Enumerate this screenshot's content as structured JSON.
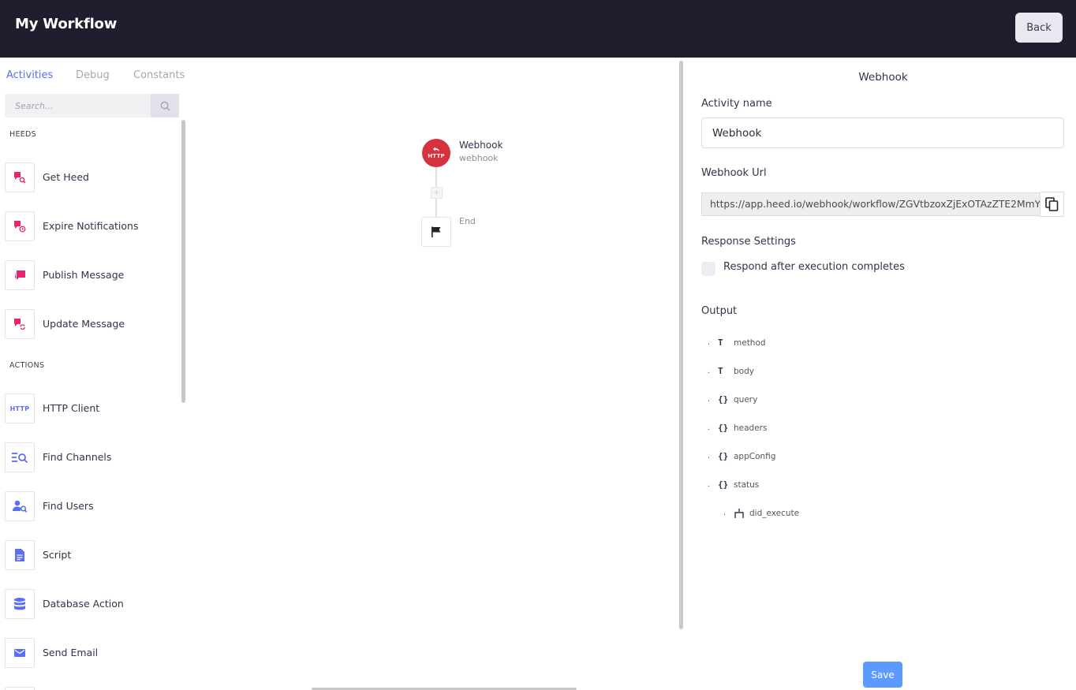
{
  "header": {
    "title": "My Workflow",
    "back_label": "Back"
  },
  "sidebar": {
    "tabs": [
      {
        "label": "Activities",
        "active": true
      },
      {
        "label": "Debug",
        "active": false
      },
      {
        "label": "Constants",
        "active": false
      }
    ],
    "search": {
      "placeholder": "Search...",
      "value": ""
    },
    "sections": [
      {
        "label": "HEEDS",
        "items": [
          {
            "label": "Get Heed",
            "icon": "heed-search-icon"
          },
          {
            "label": "Expire Notifications",
            "icon": "heed-expire-icon"
          },
          {
            "label": "Publish Message",
            "icon": "message-icon"
          },
          {
            "label": "Update Message",
            "icon": "heed-update-icon"
          }
        ]
      },
      {
        "label": "ACTIONS",
        "items": [
          {
            "label": "HTTP Client",
            "icon": "http-icon",
            "icon_text": "HTTP"
          },
          {
            "label": "Find Channels",
            "icon": "find-channels-icon"
          },
          {
            "label": "Find Users",
            "icon": "find-users-icon"
          },
          {
            "label": "Script",
            "icon": "document-icon"
          },
          {
            "label": "Database Action",
            "icon": "database-icon"
          },
          {
            "label": "Send Email",
            "icon": "email-icon"
          }
        ]
      }
    ]
  },
  "canvas": {
    "nodes": [
      {
        "title": "Webhook",
        "subtitle": "webhook",
        "icon": "webhook-icon",
        "icon_text": "HTTP"
      },
      {
        "title": "End",
        "subtitle": "",
        "icon": "flag-icon"
      }
    ]
  },
  "panel": {
    "title": "Webhook",
    "activity_name_label": "Activity name",
    "activity_name_value": "Webhook",
    "webhook_url_label": "Webhook Url",
    "webhook_url_value": "https://app.heed.io/webhook/workflow/ZGVtbzoxZjExOTAzZTE2MmY",
    "response_settings_label": "Response Settings",
    "respond_after_label": "Respond after execution completes",
    "respond_after_checked": false,
    "output_label": "Output",
    "output": [
      {
        "bullet": ".",
        "type": "T",
        "key": "method",
        "depth": 0
      },
      {
        "bullet": ".",
        "type": "T",
        "key": "body",
        "depth": 0
      },
      {
        "bullet": ".",
        "type": "{}",
        "key": "query",
        "depth": 0
      },
      {
        "bullet": ".",
        "type": "{}",
        "key": "headers",
        "depth": 0
      },
      {
        "bullet": ".",
        "type": "{}",
        "key": "appConfig",
        "depth": 0
      },
      {
        "bullet": ".",
        "type": "{}",
        "key": "status",
        "depth": 0
      },
      {
        "bullet": ".",
        "type": "boolean",
        "key": "did_execute",
        "depth": 1
      }
    ],
    "save_label": "Save"
  },
  "colors": {
    "header_bg": "#1f1d2e",
    "accent": "#5b6ef5",
    "heed_pink": "#e8256f",
    "action_blue": "#5b6ef5",
    "webhook_red": "#d6323e",
    "save_blue": "#5b9bff"
  }
}
